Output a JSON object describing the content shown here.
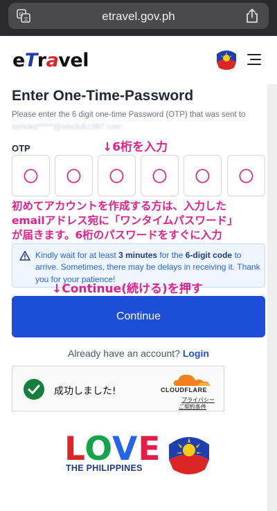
{
  "browser": {
    "url": "etravel.gov.ph"
  },
  "header": {
    "logo_e": "e",
    "logo_t": "T",
    "logo_r": "r",
    "logo_a": "a",
    "logo_rest": "vel"
  },
  "page": {
    "title": "Enter One-Time-Password",
    "description": "Please enter the 6 digit one-time Password (OTP) that was sent to",
    "email_masked": "tomoko*****@smclub1997.com",
    "otp_label": "OTP",
    "otp_digits": [
      "〇",
      "〇",
      "〇",
      "〇",
      "〇",
      "〇"
    ]
  },
  "annotations": {
    "enter_digits": "↓6桁を入力",
    "note_line1": "初めてアカウントを作成する方は、入力した",
    "note_line2": "emailアドレス宛に「ワンタイムパスワード」",
    "note_line3": "が届きます。6桁のパスワードをすぐに入力",
    "press_continue": "↓Continue(続ける)を押す"
  },
  "info": {
    "part1": "Kindly wait for at least ",
    "minutes": "3 minutes",
    "part2": " for the ",
    "digit_code": "6-digit code",
    "part3": " to arrive. Sometimes, there may be delays in receiving it. Thank you for your patience!"
  },
  "actions": {
    "continue_label": "Continue",
    "account_prompt": "Already have an account?",
    "login_label": "Login"
  },
  "cloudflare": {
    "success_text": "成功しました!",
    "brand": "CLOUDFLARE",
    "privacy": "プライバシー",
    "terms": "ご契約条件"
  },
  "footer": {
    "love_l": "L",
    "love_o": "O",
    "love_v": "V",
    "love_e": "E",
    "love_sub": "THE PHILIPPINES"
  },
  "colors": {
    "primary": "#1d4ed8",
    "annotation": "#e0218a",
    "success": "#15803d"
  }
}
